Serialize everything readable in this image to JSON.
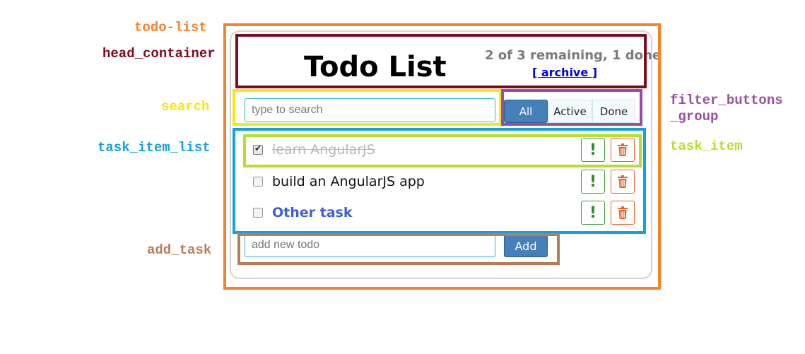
{
  "annotations": {
    "todo_list": "todo-list",
    "head_container": "head_container",
    "search": "search",
    "task_item_list": "task_item_list",
    "add_task": "add_task",
    "filter_buttons_group_line1": "filter_buttons",
    "filter_buttons_group_line2": "_group",
    "task_item": "task_item"
  },
  "colors": {
    "todo_list": "#f5832d",
    "head_container": "#7d0c1e",
    "search": "#f7e618",
    "task_item_list": "#10a3df",
    "add_task": "#b87d58",
    "filter_buttons_group": "#9a4ea0",
    "task_item": "#b7de2a"
  },
  "app": {
    "title": "Todo List",
    "summary": "2 of 3 remaining, 1 done",
    "archive_link": "[ archive ]"
  },
  "search": {
    "placeholder": "type to search"
  },
  "filters": [
    {
      "label": "All",
      "selected": true
    },
    {
      "label": "Active",
      "selected": false
    },
    {
      "label": "Done",
      "selected": false
    }
  ],
  "tasks": [
    {
      "text": "learn AngularJS",
      "done": true,
      "important": false,
      "important_button": "!",
      "delete_icon": "trash-icon"
    },
    {
      "text": "build an AngularJS app",
      "done": false,
      "important": false,
      "important_button": "!",
      "delete_icon": "trash-icon"
    },
    {
      "text": "Other task",
      "done": false,
      "important": true,
      "important_button": "!",
      "delete_icon": "trash-icon"
    }
  ],
  "add": {
    "placeholder": "add new todo",
    "button_label": "Add"
  }
}
